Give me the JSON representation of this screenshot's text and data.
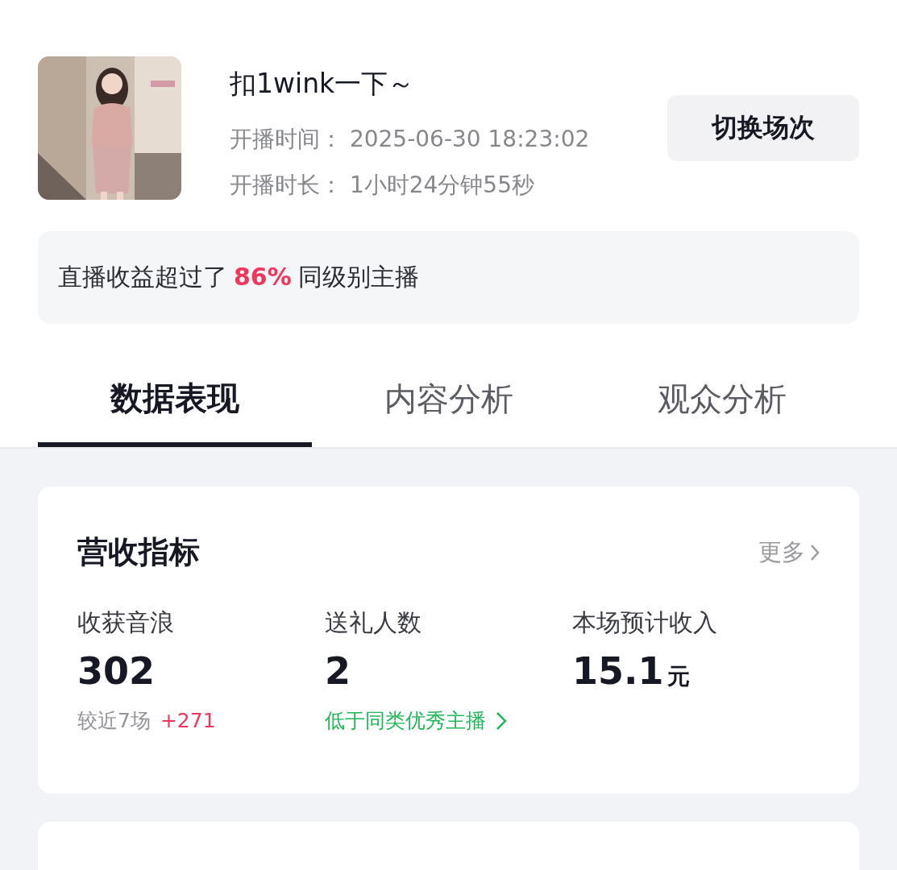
{
  "stream": {
    "title": "扣1wink一下～",
    "start_label": "开播时间：",
    "start_time": "2025-06-30 18:23:02",
    "duration_label": "开播时长：",
    "duration": "1小时24分钟55秒",
    "switch_button": "切换场次"
  },
  "banner": {
    "prefix": "直播收益超过了",
    "highlight": "86%",
    "suffix": "同级别主播"
  },
  "tabs": [
    {
      "label": "数据表现",
      "selected": true
    },
    {
      "label": "内容分析",
      "selected": false
    },
    {
      "label": "观众分析",
      "selected": false
    }
  ],
  "revenue_card": {
    "title": "营收指标",
    "more": "更多",
    "metrics": [
      {
        "label": "收获音浪",
        "value": "302",
        "kind": "compare",
        "note": "较近7场",
        "delta": "+271"
      },
      {
        "label": "送礼人数",
        "value": "2",
        "kind": "link",
        "note": "低于同类优秀主播"
      },
      {
        "label": "本场预计收入",
        "value": "15.1",
        "unit": "元",
        "kind": "plain"
      }
    ]
  },
  "next_card": {
    "kind": "card"
  }
}
